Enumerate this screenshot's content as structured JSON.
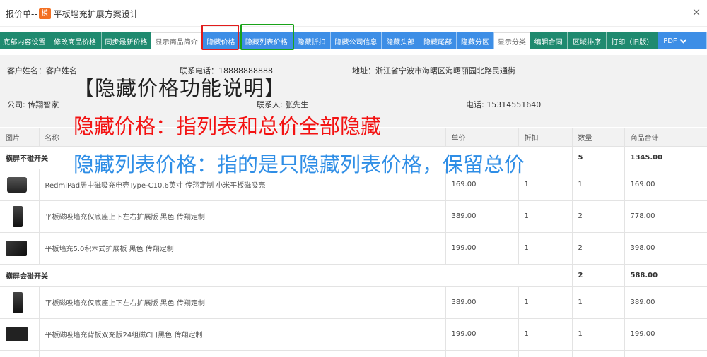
{
  "window": {
    "title_prefix": "报价单--",
    "title_badge": "模",
    "title_text": "平板墙充扩展方案设计",
    "close_glyph": "×"
  },
  "toolbar": [
    {
      "label": "底部内容设置",
      "style": "green"
    },
    {
      "label": "修改商品价格",
      "style": "green"
    },
    {
      "label": "同步最新价格",
      "style": "green"
    },
    {
      "label": "显示商品简介",
      "style": "white"
    },
    {
      "label": "隐藏价格",
      "style": "blue"
    },
    {
      "label": "隐藏列表价格",
      "style": "blue"
    },
    {
      "label": "隐藏折扣",
      "style": "blue"
    },
    {
      "label": "隐藏公司信息",
      "style": "blue"
    },
    {
      "label": "隐藏头部",
      "style": "blue"
    },
    {
      "label": "隐藏尾部",
      "style": "blue"
    },
    {
      "label": "隐藏分区",
      "style": "blue"
    },
    {
      "label": "显示分类",
      "style": "white"
    },
    {
      "label": "编辑合同",
      "style": "green"
    },
    {
      "label": "区域排序",
      "style": "green"
    },
    {
      "label": "打印（旧版）",
      "style": "green"
    },
    {
      "label": "PDF",
      "style": "pdf"
    }
  ],
  "customer": {
    "name": "客户姓名：客户姓名",
    "phone": "联系电话：18888888888",
    "address": "地址：浙江省宁波市海曙区海曙丽园北路民通街",
    "company": "公司: 传翔智家",
    "contact": "联系人: 张先生",
    "company_phone": "电话: 15314551640"
  },
  "annotations": {
    "heading": "【隐藏价格功能说明】",
    "line1": "隐藏价格：指列表和总价全部隐藏",
    "line2": "隐藏列表价格：指的是只隐藏列表价格，保留总价"
  },
  "table": {
    "headers": [
      "图片",
      "名称",
      "单价",
      "折扣",
      "数量",
      "商品合计"
    ],
    "groups": [
      {
        "name": "横屏不碰开关",
        "qty": "5",
        "total": "1345.00",
        "items": [
          {
            "name": "RedmiPad居中磁吸充电壳Type-C10.6英寸 传翔定制 小米平板磁吸壳",
            "price": "169.00",
            "discount": "1",
            "qty": "1",
            "total": "169.00",
            "thumb": "tablet-case-image"
          },
          {
            "name": "平板磁吸墙充仅底座上下左右扩展版 黑色 传翔定制",
            "price": "389.00",
            "discount": "1",
            "qty": "2",
            "total": "778.00",
            "thumb": "wall-charger-image"
          },
          {
            "name": "平板墙充5.0积木式扩展板 黑色 传翔定制",
            "price": "199.00",
            "discount": "1",
            "qty": "2",
            "total": "398.00",
            "thumb": "extension-board-image"
          }
        ]
      },
      {
        "name": "横屏会碰开关",
        "qty": "2",
        "total": "588.00",
        "items": [
          {
            "name": "平板磁吸墙充仅底座上下左右扩展版 黑色 传翔定制",
            "price": "389.00",
            "discount": "1",
            "qty": "1",
            "total": "389.00",
            "thumb": "wall-charger-image"
          },
          {
            "name": "平板磁吸墙充背板双充版24组磁C口黑色 传翔定制",
            "price": "199.00",
            "discount": "1",
            "qty": "1",
            "total": "199.00",
            "thumb": "back-plate-image"
          }
        ]
      }
    ]
  },
  "colors": {
    "toolbar_green": "#1f8a6f",
    "toolbar_blue": "#3d8ee6",
    "highlight_red": "#e21c1c",
    "highlight_green": "#19a319",
    "annotation_red": "#f31212",
    "annotation_blue": "#2f8ee6"
  }
}
